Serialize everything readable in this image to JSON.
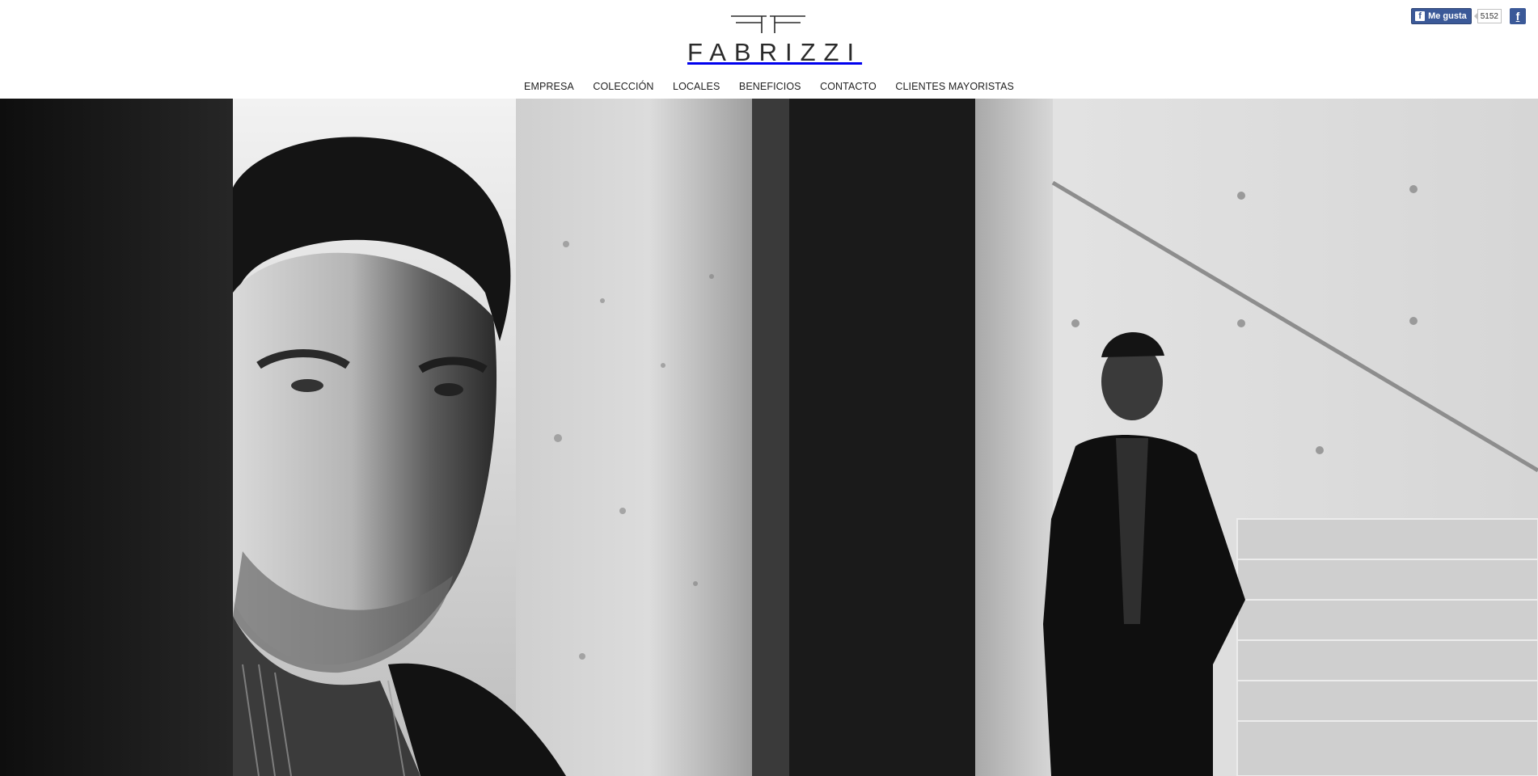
{
  "brand": {
    "name": "FABRIZZI"
  },
  "nav": {
    "items": [
      {
        "label": "EMPRESA"
      },
      {
        "label": "COLECCIÓN"
      },
      {
        "label": "LOCALES"
      },
      {
        "label": "BENEFICIOS"
      },
      {
        "label": "CONTACTO"
      },
      {
        "label": "CLIENTES MAYORISTAS"
      }
    ]
  },
  "facebook": {
    "like_label": "Me gusta",
    "like_count": "5152",
    "page_icon": "f"
  },
  "hero": {
    "style": "black-and-white photograph",
    "panels": 2
  },
  "colors": {
    "background": "#ffffff",
    "text": "#222222",
    "facebook_blue": "#3b5998"
  }
}
